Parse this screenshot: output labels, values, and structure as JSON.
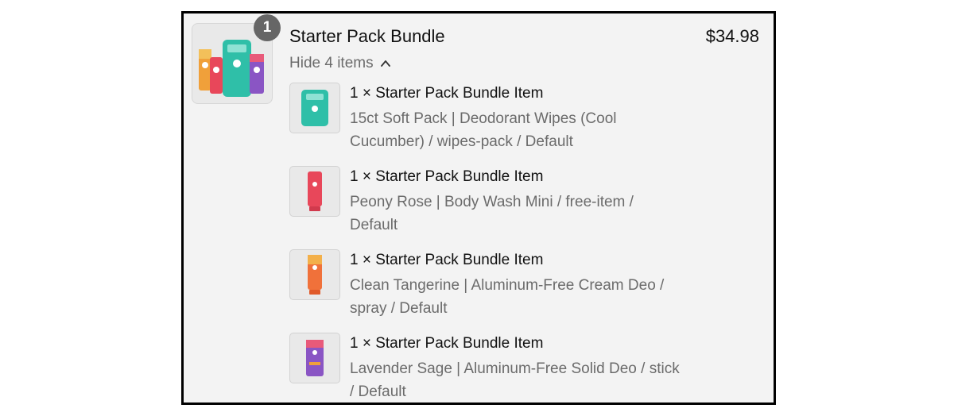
{
  "bundle": {
    "quantity": "1",
    "title": "Starter Pack Bundle",
    "price": "$34.98",
    "toggle_label": "Hide 4 items",
    "toggle_icon": "chevron-up-icon"
  },
  "items": [
    {
      "title": "1 × Starter Pack Bundle Item",
      "description": "15ct Soft Pack | Deodorant Wipes (Cool Cucumber) / wipes-pack / Default",
      "color": "#2fbfa8"
    },
    {
      "title": "1 × Starter Pack Bundle Item",
      "description": "Peony Rose | Body Wash Mini / free-item / Default",
      "color": "#e8475a"
    },
    {
      "title": "1 × Starter Pack Bundle Item",
      "description": "Clean Tangerine | Aluminum-Free Cream Deo / spray / Default",
      "color": "#f0713a"
    },
    {
      "title": "1 × Starter Pack Bundle Item",
      "description": "Lavender Sage | Aluminum-Free Solid Deo / stick / Default",
      "color": "#8a55c4"
    }
  ]
}
